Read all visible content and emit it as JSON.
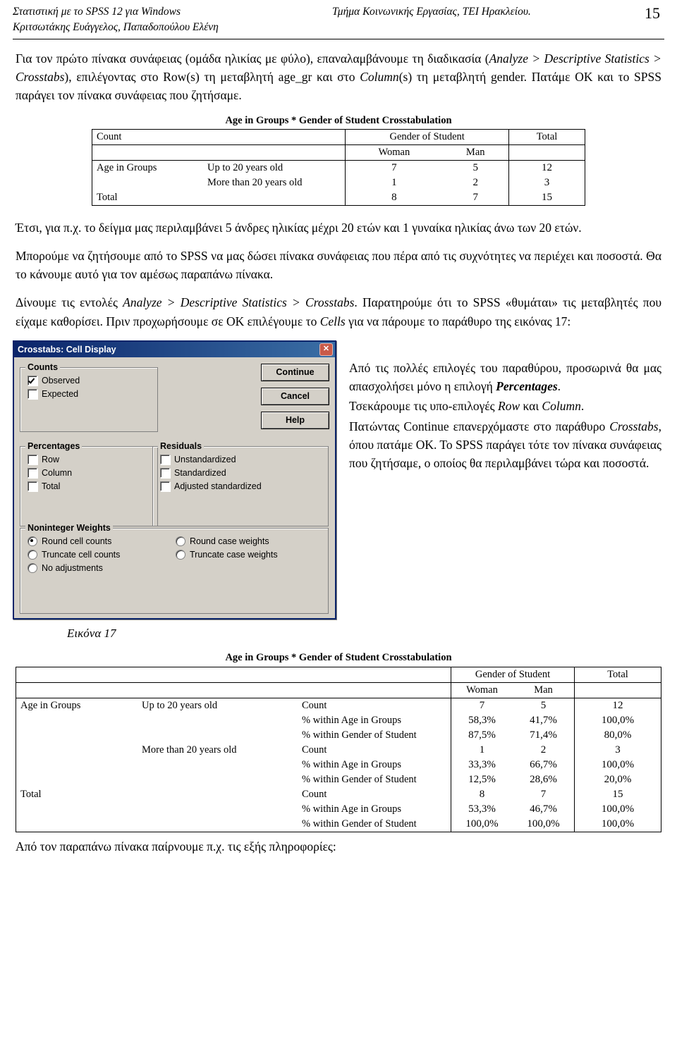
{
  "header": {
    "left_line1": "Στατιστική με το SPSS 12  για Windows",
    "left_line2": "Κριτσωτάκης Ευάγγελος, Παπαδοπούλου Ελένη",
    "center": "Τμήμα Κοινωνικής Εργασίας, ΤΕΙ Ηρακλείου.",
    "page_number": "15"
  },
  "paragraphs": {
    "p1_a": "Για τον πρώτο πίνακα συνάφειας (ομάδα ηλικίας με φύλο), επαναλαμβάνουμε τη διαδικασία (",
    "p1_italic1": "Analyze > Descriptive Statistics > Crosstabs",
    "p1_b": "), επιλέγοντας στο Row(s) τη μεταβλητή age_gr και στο ",
    "p1_italic2": "Column",
    "p1_c": "(s) τη μεταβλητή gender. Πατάμε ΟΚ και το SPSS παράγει τον πίνακα συνάφειας που ζητήσαμε.",
    "p2": "Έτσι, για π.χ. το δείγμα μας περιλαμβάνει 5 άνδρες ηλικίας μέχρι 20 ετών και 1 γυναίκα ηλικίας άνω των 20 ετών.",
    "p3": "Μπορούμε να ζητήσουμε από το SPSS να μας δώσει πίνακα συνάφειας που πέρα από τις συχνότητες να περιέχει και ποσοστά. Θα το κάνουμε αυτό για τον αμέσως παραπάνω πίνακα.",
    "p4_a": "Δίνουμε τις εντολές ",
    "p4_italic1": "Analyze > Descriptive Statistics > Crosstabs",
    "p4_b": ". Παρατηρούμε ότι το SPSS «θυμάται» τις μεταβλητές που είχαμε καθορίσει. Πριν προχωρήσουμε σε ΟΚ επιλέγουμε το ",
    "p4_italic2": "Cells",
    "p4_c": " για να πάρουμε το παράθυρο της εικόνας 17:",
    "p_footer": "Από τον παραπάνω πίνακα παίρνουμε π.χ. τις εξής πληροφορίες:"
  },
  "side_text": {
    "l1_a": "Από τις πολλές επιλογές του παραθύρου, προσωρινά θα μας απασχολήσει μόνο η επιλογή ",
    "l1_italic": "Percentages",
    "l1_b": ".",
    "l2_a": "Τσεκάρουμε τις υπο-επιλογές ",
    "l2_italic1": "Row",
    "l2_b": " και ",
    "l2_italic2": "Column",
    "l2_c": ".",
    "l3_a": "Πατώντας Continue επανερχόμαστε στο παράθυρο ",
    "l3_italic": "Crosstabs",
    "l3_b": ", όπου πατάμε ΟΚ. Το SPSS παράγει τότε τον πίνακα συνάφειας που ζητήσαμε, ο οποίος θα περιλαμβάνει τώρα και ποσοστά."
  },
  "table1": {
    "title": "Age in Groups * Gender of Student Crosstabulation",
    "count_label": "Count",
    "col_group": "Gender of Student",
    "total_label": "Total",
    "col_headers": [
      "Woman",
      "Man"
    ],
    "row_var": "Age in Groups",
    "rows": [
      {
        "label": "Up to 20 years old",
        "values": [
          "7",
          "5",
          "12"
        ]
      },
      {
        "label": "More than 20 years old",
        "values": [
          "1",
          "2",
          "3"
        ]
      }
    ],
    "total_row": {
      "label": "Total",
      "values": [
        "8",
        "7",
        "15"
      ]
    }
  },
  "table2": {
    "title": "Age in Groups * Gender of Student Crosstabulation",
    "col_group": "Gender of Student",
    "total_label": "Total",
    "col_headers": [
      "Woman",
      "Man"
    ],
    "row_var": "Age in Groups",
    "stat_labels": [
      "Count",
      "% within Age in Groups",
      "% within Gender of Student"
    ],
    "groups": [
      {
        "label": "Up to 20 years old",
        "rows": [
          [
            "7",
            "5",
            "12"
          ],
          [
            "58,3%",
            "41,7%",
            "100,0%"
          ],
          [
            "87,5%",
            "71,4%",
            "80,0%"
          ]
        ]
      },
      {
        "label": "More than 20 years old",
        "rows": [
          [
            "1",
            "2",
            "3"
          ],
          [
            "33,3%",
            "66,7%",
            "100,0%"
          ],
          [
            "12,5%",
            "28,6%",
            "20,0%"
          ]
        ]
      },
      {
        "label": "Total",
        "rows": [
          [
            "8",
            "7",
            "15"
          ],
          [
            "53,3%",
            "46,7%",
            "100,0%"
          ],
          [
            "100,0%",
            "100,0%",
            "100,0%"
          ]
        ]
      }
    ]
  },
  "dialog": {
    "title": "Crosstabs: Cell Display",
    "close_glyph": "✕",
    "counts": {
      "legend": "Counts",
      "items": [
        {
          "label": "Observed",
          "checked": true
        },
        {
          "label": "Expected",
          "checked": false
        }
      ]
    },
    "percentages": {
      "legend": "Percentages",
      "items": [
        {
          "label": "Row",
          "checked": false
        },
        {
          "label": "Column",
          "checked": false
        },
        {
          "label": "Total",
          "checked": false
        }
      ]
    },
    "residuals": {
      "legend": "Residuals",
      "items": [
        {
          "label": "Unstandardized",
          "checked": false
        },
        {
          "label": "Standardized",
          "checked": false
        },
        {
          "label": "Adjusted standardized",
          "checked": false
        }
      ]
    },
    "weights": {
      "legend": "Noninteger Weights",
      "left": [
        {
          "label": "Round cell counts",
          "selected": true
        },
        {
          "label": "Truncate cell counts",
          "selected": false
        },
        {
          "label": "No adjustments",
          "selected": false
        }
      ],
      "right": [
        {
          "label": "Round case weights",
          "selected": false
        },
        {
          "label": "Truncate case weights",
          "selected": false
        }
      ]
    },
    "buttons": [
      "Continue",
      "Cancel",
      "Help"
    ]
  },
  "figure_caption": "Εικόνα 17"
}
